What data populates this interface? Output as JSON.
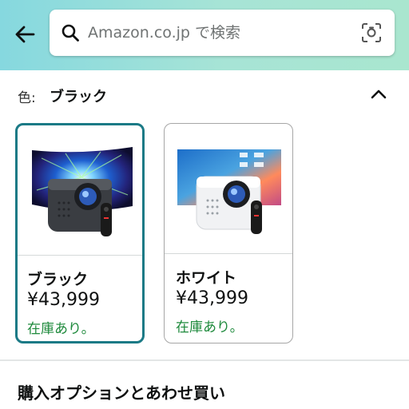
{
  "search": {
    "placeholder": "Amazon.co.jp で検索"
  },
  "color_selector": {
    "label": "色:",
    "selected_value": "ブラック"
  },
  "variants": [
    {
      "name": "ブラック",
      "price": "¥43,999",
      "stock": "在庫あり。",
      "selected": true
    },
    {
      "name": "ホワイト",
      "price": "¥43,999",
      "stock": "在庫あり。",
      "selected": false
    }
  ],
  "section": {
    "title": "購入オプションとあわせ買い"
  },
  "colors": {
    "header_start": "#86d8df",
    "header_end": "#a9e6cf",
    "selected_border": "#1b7a86",
    "in_stock": "#1e8a3c"
  }
}
